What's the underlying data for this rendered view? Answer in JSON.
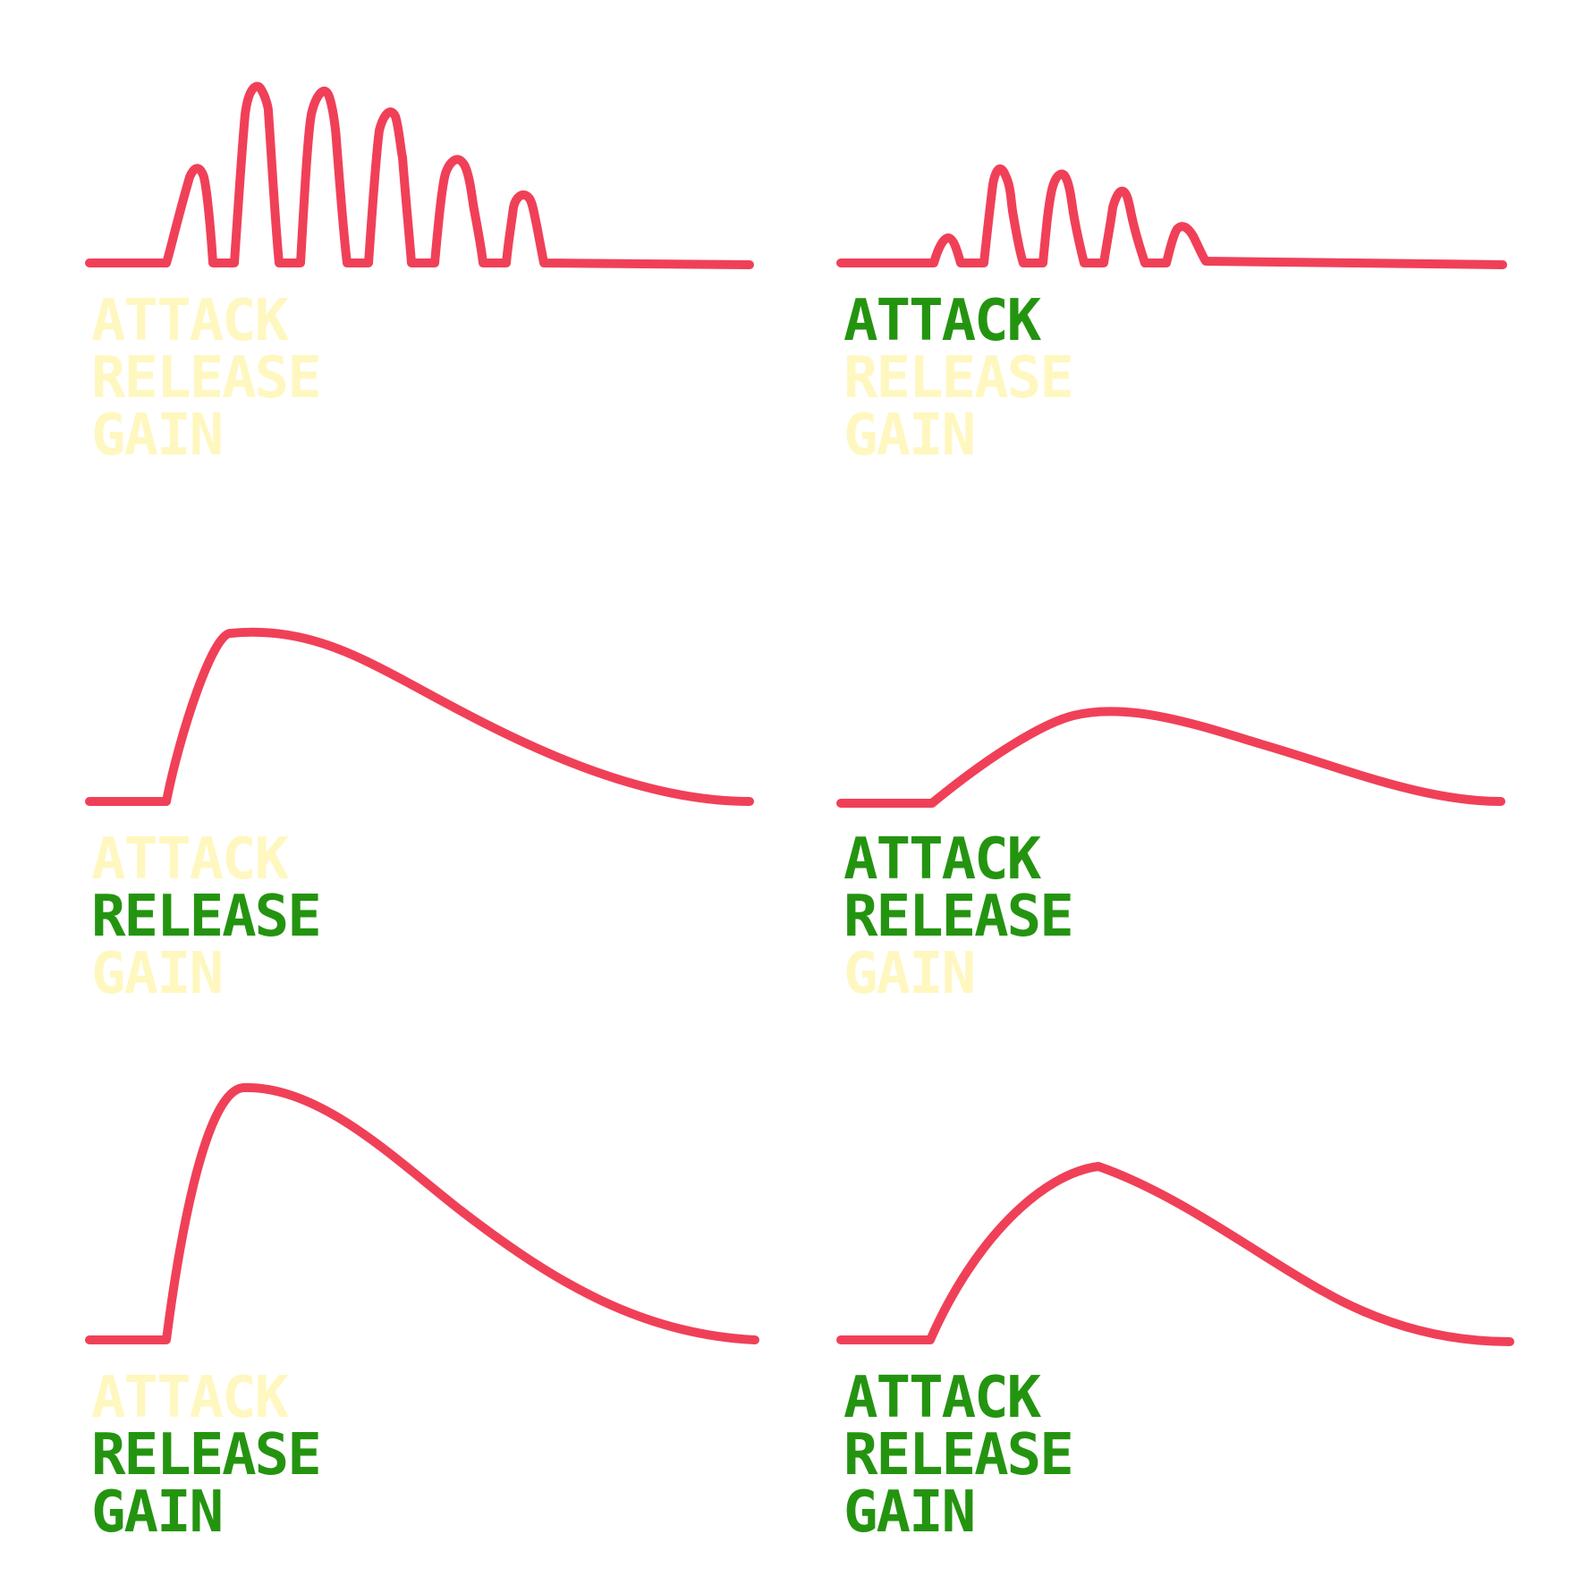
{
  "colors": {
    "curve": "#f04058",
    "active": "#249410",
    "inactive": "#fff7c0",
    "background": "#ffffff"
  },
  "panels": [
    {
      "id": "panel-1",
      "labels": [
        {
          "text": "ATTACK",
          "active": false
        },
        {
          "text": "RELEASE",
          "active": false
        },
        {
          "text": "GAIN",
          "active": false
        }
      ]
    },
    {
      "id": "panel-2",
      "labels": [
        {
          "text": "ATTACK",
          "active": true
        },
        {
          "text": "RELEASE",
          "active": false
        },
        {
          "text": "GAIN",
          "active": false
        }
      ]
    },
    {
      "id": "panel-3",
      "labels": [
        {
          "text": "ATTACK",
          "active": false
        },
        {
          "text": "RELEASE",
          "active": true
        },
        {
          "text": "GAIN",
          "active": false
        }
      ]
    },
    {
      "id": "panel-4",
      "labels": [
        {
          "text": "ATTACK",
          "active": true
        },
        {
          "text": "RELEASE",
          "active": true
        },
        {
          "text": "GAIN",
          "active": false
        }
      ]
    },
    {
      "id": "panel-5",
      "labels": [
        {
          "text": "ATTACK",
          "active": false
        },
        {
          "text": "RELEASE",
          "active": true
        },
        {
          "text": "GAIN",
          "active": true
        }
      ]
    },
    {
      "id": "panel-6",
      "labels": [
        {
          "text": "ATTACK",
          "active": true
        },
        {
          "text": "RELEASE",
          "active": true
        },
        {
          "text": "GAIN",
          "active": true
        }
      ]
    }
  ]
}
